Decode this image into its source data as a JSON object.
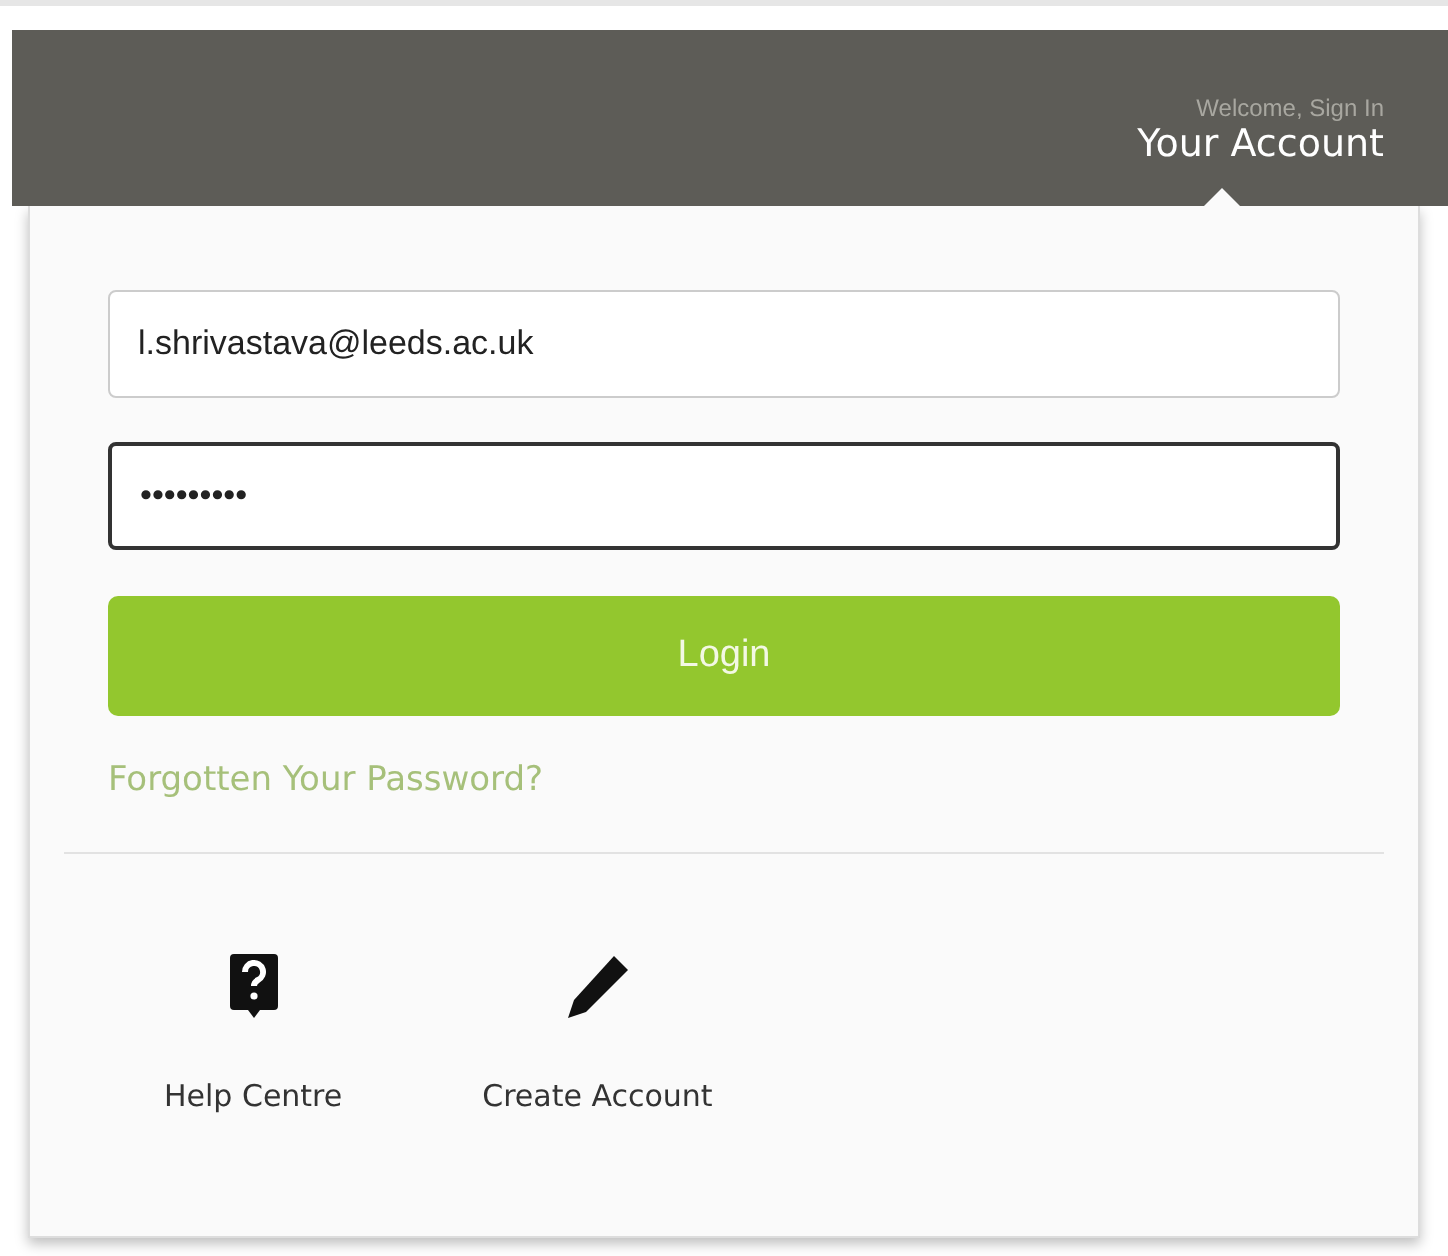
{
  "header": {
    "greeting": "Welcome, Sign In",
    "title": "Your Account"
  },
  "login": {
    "email": {
      "value": "l.shrivastava@leeds.ac.uk",
      "focused": false
    },
    "password": {
      "value": "•••••••••",
      "focused": true
    },
    "button": "Login",
    "forgot_link": "Forgotten Your Password?"
  },
  "actions": [
    {
      "kind": "help",
      "label": "Help Centre"
    },
    {
      "kind": "create",
      "label": "Create Account"
    }
  ]
}
